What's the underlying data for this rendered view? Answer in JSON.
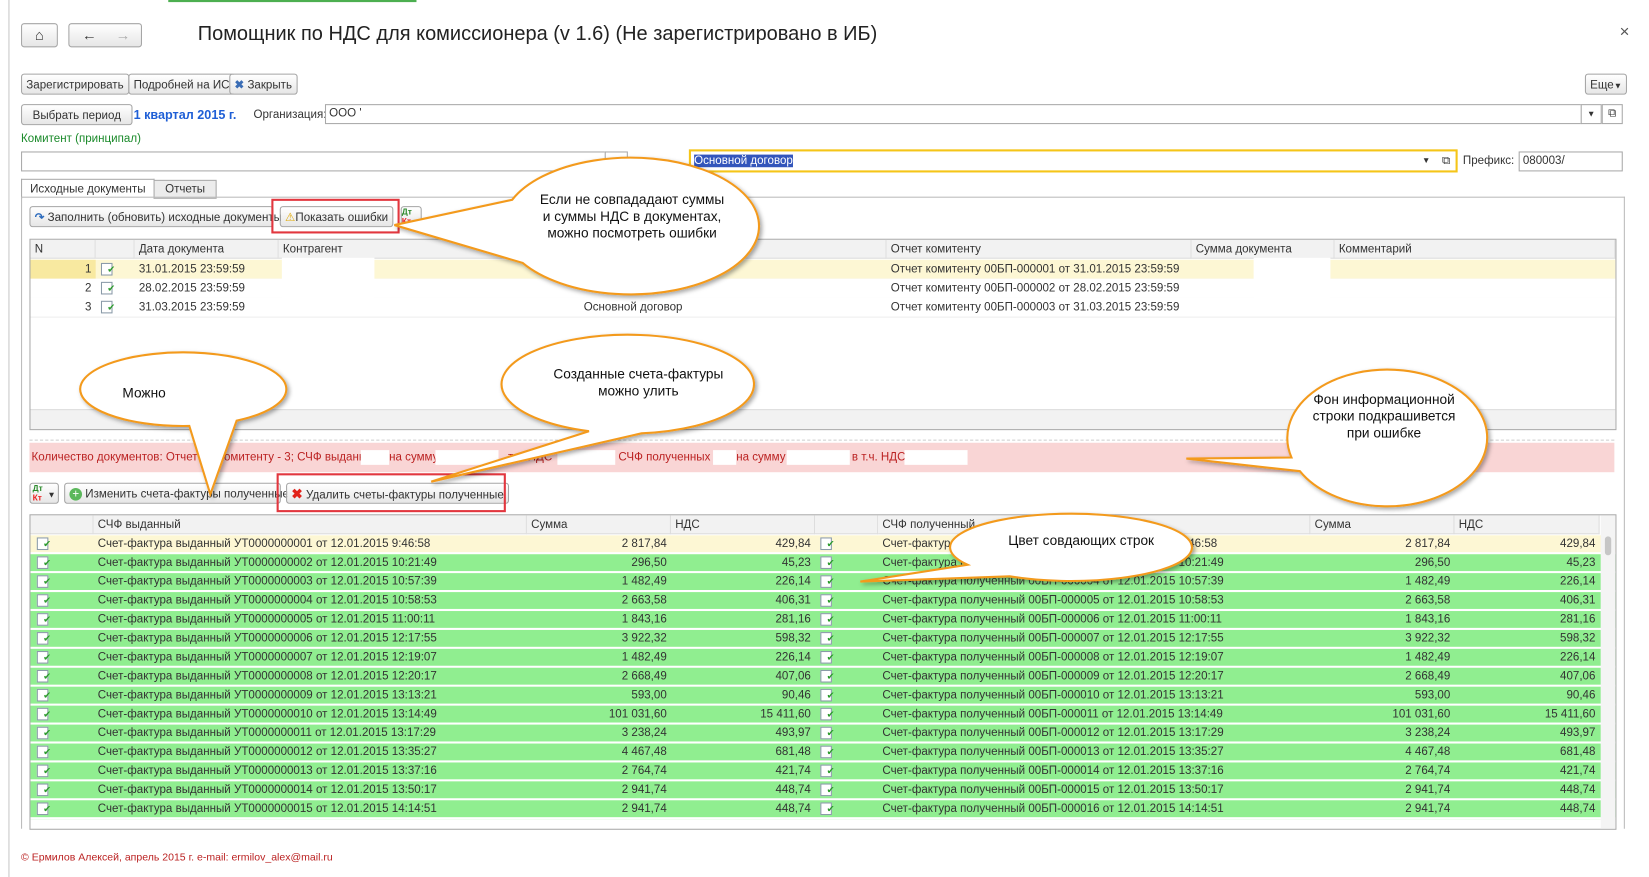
{
  "window": {
    "title": "Помощник по НДС для комиссионера (v 1.6) (Не зарегистрировано в ИБ)",
    "close": "×"
  },
  "toolbar": {
    "register": "Зарегистрировать",
    "details": "Подробней на ИС",
    "close": "Закрыть",
    "more": "Еще"
  },
  "period": {
    "button": "Выбрать период",
    "value": "1 квартал 2015 г.",
    "org_label": "Организация:",
    "org_value": "ООО '"
  },
  "principal": {
    "label": "Комитент (принципал)",
    "value": "",
    "contract_value": "Основной договор",
    "prefix_label": "Префикс:",
    "prefix_value": "080003/"
  },
  "tabs": [
    {
      "label": "Исходные документы",
      "active": true
    },
    {
      "label": "Отчеты",
      "active": false
    }
  ],
  "docs_toolbar": {
    "fill": "Заполнить (обновить) исходные документы",
    "show_errors": "Показать ошибки",
    "dtkt": "Дт Кт"
  },
  "docs_table": {
    "columns": [
      "N",
      "",
      "Дата документа",
      "Контрагент",
      "",
      "Отчет комитенту",
      "Сумма документа",
      "Комментарий"
    ],
    "rows": [
      {
        "n": "1",
        "date": "31.01.2015 23:59:59",
        "contract": "",
        "report": "Отчет комитенту 00БП-000001 от 31.01.2015 23:59:59"
      },
      {
        "n": "2",
        "date": "28.02.2015 23:59:59",
        "contract": "",
        "report": "Отчет комитенту 00БП-000002 от 28.02.2015 23:59:59"
      },
      {
        "n": "3",
        "date": "31.03.2015 23:59:59",
        "contract": "Основной договор",
        "report": "Отчет комитенту 00БП-000003 от 31.03.2015 23:59:59"
      }
    ]
  },
  "info_bar": {
    "p1": "Количество документов: Отчет",
    "p2": "комитенту - 3; СЧФ выданных",
    "p3": "на сумму",
    "p4": "т.ч. НДС",
    "p5": "СЧФ полученных -",
    "p6": "на сумму",
    "p7": "в т.ч. НДС"
  },
  "invoice_toolbar": {
    "dtkt": "Дт Кт",
    "change": "Изменить счета-фактуры полученные",
    "delete": "Удалить счеты-фактуры полученные"
  },
  "invoice_table": {
    "columns": [
      "",
      "СЧФ выданный",
      "Сумма",
      "НДС",
      "",
      "СЧФ полученный",
      "Сумма",
      "НДС"
    ],
    "rows": [
      {
        "issued": "Счет-фактура выданный УТ0000000001 от 12.01.2015 9:46:58",
        "sum": "2 817,84",
        "nds": "429,84",
        "received": "Счет-фактура полученный 00БП-000002 от 12.01.2015 9:46:58",
        "rsum": "2 817,84",
        "rnds": "429,84"
      },
      {
        "issued": "Счет-фактура выданный УТ0000000002 от 12.01.2015 10:21:49",
        "sum": "296,50",
        "nds": "45,23",
        "received": "Счет-фактура полученный 00БП-000003 от 12.01.2015 10:21:49",
        "rsum": "296,50",
        "rnds": "45,23"
      },
      {
        "issued": "Счет-фактура выданный УТ0000000003 от 12.01.2015 10:57:39",
        "sum": "1 482,49",
        "nds": "226,14",
        "received": "Счет-фактура полученный 00БП-000004 от 12.01.2015 10:57:39",
        "rsum": "1 482,49",
        "rnds": "226,14"
      },
      {
        "issued": "Счет-фактура выданный УТ0000000004 от 12.01.2015 10:58:53",
        "sum": "2 663,58",
        "nds": "406,31",
        "received": "Счет-фактура полученный 00БП-000005 от 12.01.2015 10:58:53",
        "rsum": "2 663,58",
        "rnds": "406,31"
      },
      {
        "issued": "Счет-фактура выданный УТ0000000005 от 12.01.2015 11:00:11",
        "sum": "1 843,16",
        "nds": "281,16",
        "received": "Счет-фактура полученный 00БП-000006 от 12.01.2015 11:00:11",
        "rsum": "1 843,16",
        "rnds": "281,16"
      },
      {
        "issued": "Счет-фактура выданный УТ0000000006 от 12.01.2015 12:17:55",
        "sum": "3 922,32",
        "nds": "598,32",
        "received": "Счет-фактура полученный 00БП-000007 от 12.01.2015 12:17:55",
        "rsum": "3 922,32",
        "rnds": "598,32"
      },
      {
        "issued": "Счет-фактура выданный УТ0000000007 от 12.01.2015 12:19:07",
        "sum": "1 482,49",
        "nds": "226,14",
        "received": "Счет-фактура полученный 00БП-000008 от 12.01.2015 12:19:07",
        "rsum": "1 482,49",
        "rnds": "226,14"
      },
      {
        "issued": "Счет-фактура выданный УТ0000000008 от 12.01.2015 12:20:17",
        "sum": "2 668,49",
        "nds": "407,06",
        "received": "Счет-фактура полученный 00БП-000009 от 12.01.2015 12:20:17",
        "rsum": "2 668,49",
        "rnds": "407,06"
      },
      {
        "issued": "Счет-фактура выданный УТ0000000009 от 12.01.2015 13:13:21",
        "sum": "593,00",
        "nds": "90,46",
        "received": "Счет-фактура полученный 00БП-000010 от 12.01.2015 13:13:21",
        "rsum": "593,00",
        "rnds": "90,46"
      },
      {
        "issued": "Счет-фактура выданный УТ0000000010 от 12.01.2015 13:14:49",
        "sum": "101 031,60",
        "nds": "15 411,60",
        "received": "Счет-фактура полученный 00БП-000011 от 12.01.2015 13:14:49",
        "rsum": "101 031,60",
        "rnds": "15 411,60"
      },
      {
        "issued": "Счет-фактура выданный УТ0000000011 от 12.01.2015 13:17:29",
        "sum": "3 238,24",
        "nds": "493,97",
        "received": "Счет-фактура полученный 00БП-000012 от 12.01.2015 13:17:29",
        "rsum": "3 238,24",
        "rnds": "493,97"
      },
      {
        "issued": "Счет-фактура выданный УТ0000000012 от 12.01.2015 13:35:27",
        "sum": "4 467,48",
        "nds": "681,48",
        "received": "Счет-фактура полученный 00БП-000013 от 12.01.2015 13:35:27",
        "rsum": "4 467,48",
        "rnds": "681,48"
      },
      {
        "issued": "Счет-фактура выданный УТ0000000013 от 12.01.2015 13:37:16",
        "sum": "2 764,74",
        "nds": "421,74",
        "received": "Счет-фактура полученный 00БП-000014 от 12.01.2015 13:37:16",
        "rsum": "2 764,74",
        "rnds": "421,74"
      },
      {
        "issued": "Счет-фактура выданный УТ0000000014 от 12.01.2015 13:50:17",
        "sum": "2 941,74",
        "nds": "448,74",
        "received": "Счет-фактура полученный 00БП-000015 от 12.01.2015 13:50:17",
        "rsum": "2 941,74",
        "rnds": "448,74"
      },
      {
        "issued": "Счет-фактура выданный УТ0000000015 от 12.01.2015 14:14:51",
        "sum": "2 941,74",
        "nds": "448,74",
        "received": "Счет-фактура полученный 00БП-000016 от 12.01.2015 14:14:51",
        "rsum": "2 941,74",
        "rnds": "448,74"
      }
    ]
  },
  "callouts": {
    "errors": "Если не совпададают суммы и суммы НДС в документах, можно посмотреть ошибки",
    "can": "Можно",
    "delete": "Созданные счета-фактуры можно улить",
    "background": "Фон информационной строки подкрашивется при ошибке",
    "color": "Цвет совдающих строк"
  },
  "footer": "© Ермилов Алексей, апрель 2015 г. e-mail: ermilov_alex@mail.ru",
  "colors": {
    "match_row": "#90ee90",
    "current_row": "#fdf7d4",
    "info_bar_error": "#f9d5d5",
    "accent_orange": "#f39a1e",
    "highlight_red": "#e2373f",
    "link_blue": "#1f5fd6",
    "green_label": "#1a8a2a"
  }
}
